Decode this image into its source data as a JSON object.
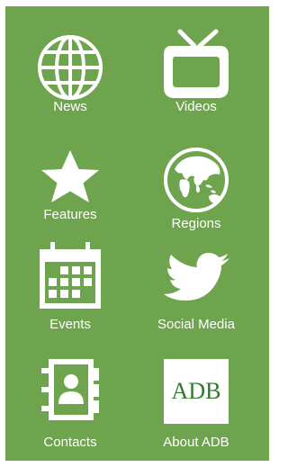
{
  "menu": {
    "background_color": "#6fa44e",
    "items": [
      {
        "label": "News",
        "icon": "globe-icon"
      },
      {
        "label": "Videos",
        "icon": "tv-icon"
      },
      {
        "label": "Features",
        "icon": "star-icon"
      },
      {
        "label": "Regions",
        "icon": "world-map-icon"
      },
      {
        "label": "Events",
        "icon": "calendar-icon"
      },
      {
        "label": "Social Media",
        "icon": "twitter-bird-icon"
      },
      {
        "label": "Contacts",
        "icon": "address-book-icon"
      },
      {
        "label": "About ADB",
        "icon": "adb-logo-icon",
        "logo_text": "ADB"
      }
    ]
  }
}
